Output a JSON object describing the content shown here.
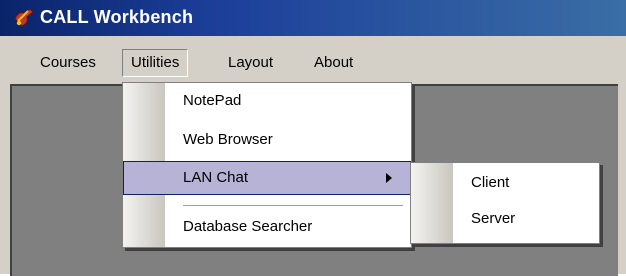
{
  "window": {
    "title": "CALL Workbench",
    "icon": "app-tools-icon",
    "title_gradient_start": "#0a246a",
    "title_gradient_end": "#3a6ea5"
  },
  "menubar": {
    "items": [
      "Courses",
      "Utilities",
      "Layout",
      "About"
    ],
    "open_menu": "Utilities"
  },
  "utilities_menu": {
    "items": [
      "NotePad",
      "Web Browser",
      "LAN Chat",
      "Database Searcher"
    ],
    "highlighted": "LAN Chat",
    "highlight_color": "#b6b3d6"
  },
  "lan_chat_submenu": {
    "items": [
      "Client",
      "Server"
    ]
  }
}
